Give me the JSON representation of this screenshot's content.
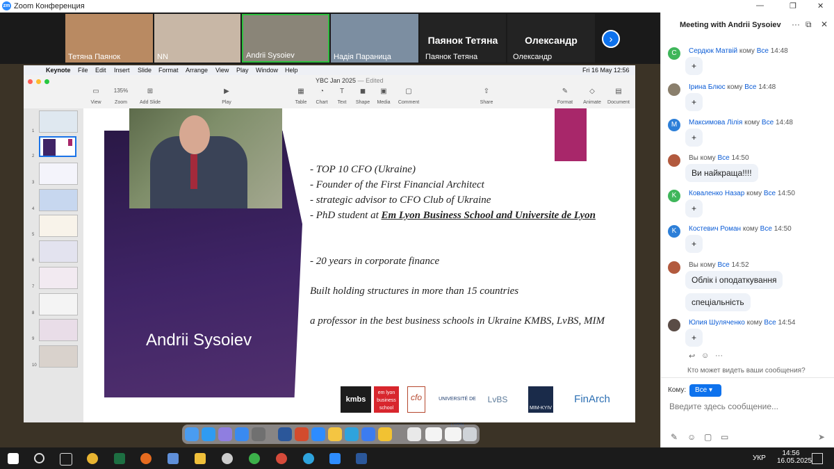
{
  "window": {
    "title": "Zoom Конференция",
    "logo": "zm"
  },
  "gallery": {
    "participants": [
      {
        "name": "Тетяна Паянок",
        "color": "#b98a62"
      },
      {
        "name": "NN",
        "color": "#c8b7a6"
      },
      {
        "name": "Andrii Sysoiev",
        "color": "#8a8578"
      },
      {
        "name": "Надія Параница",
        "color": "#7c8ea1"
      }
    ],
    "name_tiles": [
      {
        "big": "Паянок Тетяна",
        "small": "Паянок Тетяна"
      },
      {
        "big": "Олександр",
        "small": "Олександр"
      }
    ],
    "next_glyph": "›"
  },
  "mac_menu": {
    "items": [
      "Keynote",
      "File",
      "Edit",
      "Insert",
      "Slide",
      "Format",
      "Arrange",
      "View",
      "Play",
      "Window",
      "Help"
    ],
    "clock": "Fri 16 May  12:56"
  },
  "keynote": {
    "doc_title": "YBC Jan 2025",
    "doc_state": "— Edited",
    "zoom": "135%",
    "toolbar": [
      "View",
      "Zoom",
      "Add Slide",
      "Play",
      "Table",
      "Chart",
      "Text",
      "Shape",
      "Media",
      "Comment",
      "Share",
      "Format",
      "Animate",
      "Document"
    ],
    "thumb_numbers": [
      "1",
      "2",
      "3",
      "4",
      "5",
      "6",
      "7",
      "8",
      "9",
      "10"
    ]
  },
  "slide": {
    "presenter_name": "Andrii Sysoiev",
    "bullets": [
      "- TOP 10 CFO  (Ukraine)",
      "- Founder of the First Financial Architect",
      "- strategic advisor to CFO Club of Ukraine",
      "- PhD student at ",
      "- 20 years in corporate finance",
      "Built holding structures in more than 15 countries",
      "a professor in the best business schools in Ukraine KMBS, LvBS, MIM"
    ],
    "phd_school": "Em Lyon Business School and Universite de Lyon",
    "logos": [
      "kmbs",
      "em lyon business school",
      "cfo",
      "UNIVERSITÉ DE LYON",
      "LvBS",
      "MIM-KYIV",
      "FinArch"
    ]
  },
  "chat": {
    "title": "Meeting with Andrii Sysoiev",
    "messages": [
      {
        "sender": "Сердюк Матвій",
        "to": "Все",
        "time": "14:48",
        "text": "+",
        "initial": "C",
        "color": "#3fb65a"
      },
      {
        "sender": "Ірина Блюс",
        "to": "Все",
        "time": "14:48",
        "text": "+",
        "initial": "",
        "color": "#8a7f6c"
      },
      {
        "sender": "Максимова Лілія",
        "to": "Все",
        "time": "14:48",
        "text": "+",
        "initial": "M",
        "color": "#2d7fd8"
      },
      {
        "sender": "Вы",
        "to": "Все",
        "time": "14:50",
        "text": "Ви найкраща!!!!",
        "initial": "",
        "color": "#b25a3e"
      },
      {
        "sender": "Коваленко Назар",
        "to": "Все",
        "time": "14:50",
        "text": "+",
        "initial": "K",
        "color": "#3fb65a"
      },
      {
        "sender": "Костевич Роман",
        "to": "Все",
        "time": "14:50",
        "text": "+",
        "initial": "K",
        "color": "#2d7fd8"
      },
      {
        "sender": "Вы",
        "to": "Все",
        "time": "14:52",
        "text": "Облік і оподаткування",
        "text2": "спеціальність",
        "initial": "",
        "color": "#b25a3e"
      },
      {
        "sender": "Юлия Шуляченко",
        "to": "Все",
        "time": "14:54",
        "text": "+",
        "initial": "",
        "color": "#5a4c46"
      }
    ],
    "kom_word": "кому",
    "visibility": "Кто может видеть ваши сообщения?",
    "recipient_label": "Кому:",
    "recipient": "Все",
    "input_placeholder": "Введите здесь сообщение..."
  },
  "taskbar": {
    "time": "14:56",
    "date": "16.05.2025",
    "lang": "УКР"
  }
}
